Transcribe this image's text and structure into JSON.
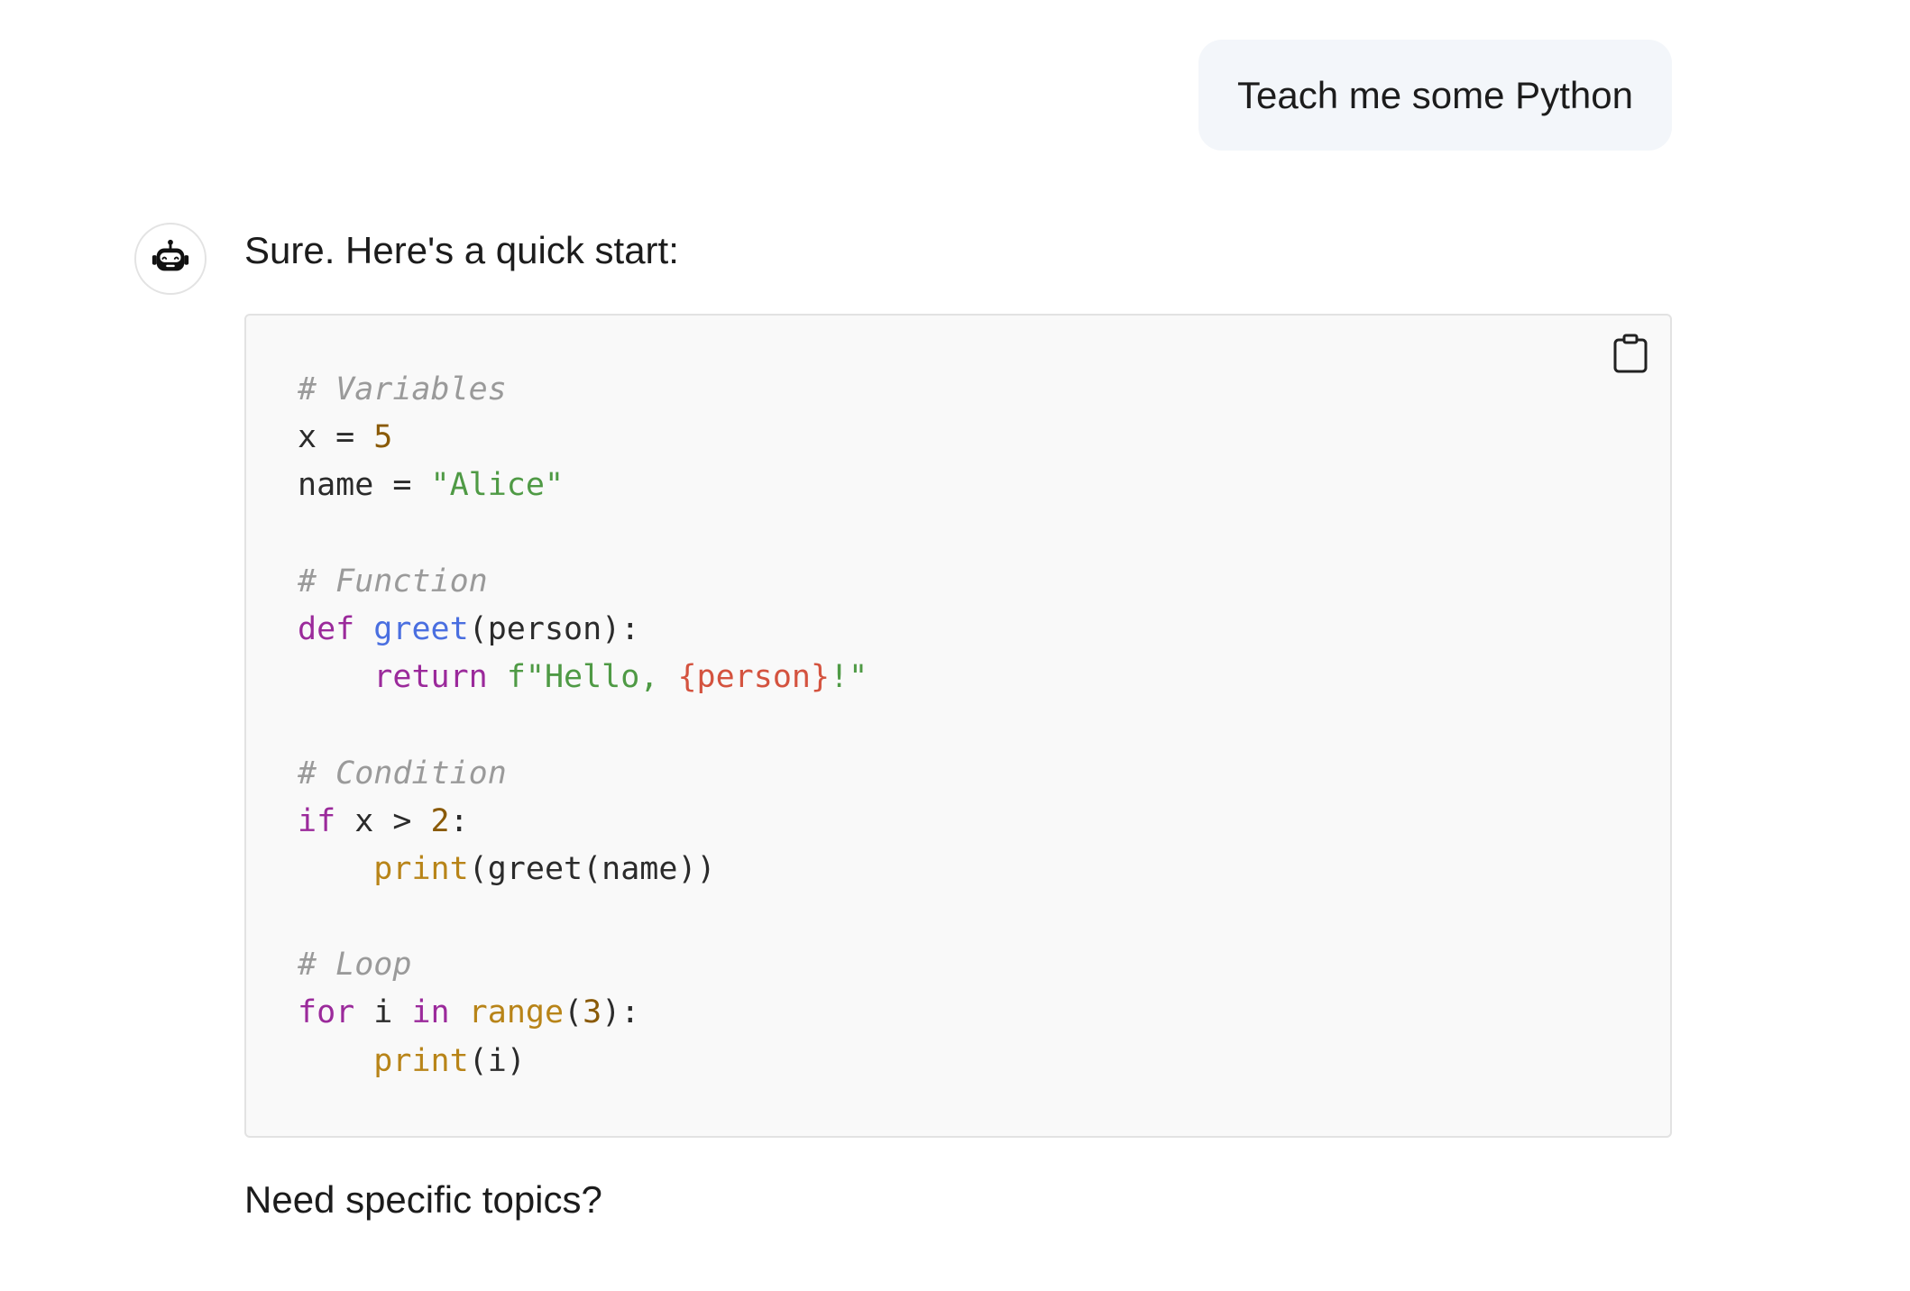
{
  "user_message": {
    "text": "Teach me some Python"
  },
  "assistant": {
    "avatar_icon": "robot-icon",
    "intro": "Sure. Here's a quick start:",
    "outro": "Need specific topics?",
    "code_block": {
      "language": "python",
      "copy_icon": "clipboard-icon",
      "lines": [
        [
          {
            "t": "comment",
            "v": "# Variables"
          }
        ],
        [
          {
            "t": "plain",
            "v": "x = "
          },
          {
            "t": "number",
            "v": "5"
          }
        ],
        [
          {
            "t": "plain",
            "v": "name = "
          },
          {
            "t": "string",
            "v": "\"Alice\""
          }
        ],
        [],
        [
          {
            "t": "comment",
            "v": "# Function"
          }
        ],
        [
          {
            "t": "keyword",
            "v": "def"
          },
          {
            "t": "plain",
            "v": " "
          },
          {
            "t": "funcname",
            "v": "greet"
          },
          {
            "t": "plain",
            "v": "(person):"
          }
        ],
        [
          {
            "t": "plain",
            "v": "    "
          },
          {
            "t": "keyword",
            "v": "return"
          },
          {
            "t": "plain",
            "v": " "
          },
          {
            "t": "string",
            "v": "f\"Hello, "
          },
          {
            "t": "interp",
            "v": "{person}"
          },
          {
            "t": "string",
            "v": "!\""
          }
        ],
        [],
        [
          {
            "t": "comment",
            "v": "# Condition"
          }
        ],
        [
          {
            "t": "keyword",
            "v": "if"
          },
          {
            "t": "plain",
            "v": " x > "
          },
          {
            "t": "number",
            "v": "2"
          },
          {
            "t": "plain",
            "v": ":"
          }
        ],
        [
          {
            "t": "plain",
            "v": "    "
          },
          {
            "t": "builtin",
            "v": "print"
          },
          {
            "t": "plain",
            "v": "(greet(name))"
          }
        ],
        [],
        [
          {
            "t": "comment",
            "v": "# Loop"
          }
        ],
        [
          {
            "t": "keyword",
            "v": "for"
          },
          {
            "t": "plain",
            "v": " i "
          },
          {
            "t": "keyword",
            "v": "in"
          },
          {
            "t": "plain",
            "v": " "
          },
          {
            "t": "builtin",
            "v": "range"
          },
          {
            "t": "plain",
            "v": "("
          },
          {
            "t": "number",
            "v": "3"
          },
          {
            "t": "plain",
            "v": "):"
          }
        ],
        [
          {
            "t": "plain",
            "v": "    "
          },
          {
            "t": "builtin",
            "v": "print"
          },
          {
            "t": "plain",
            "v": "(i)"
          }
        ]
      ]
    }
  },
  "colors": {
    "user_bubble_bg": "#f3f6fa",
    "code_bg": "#f9f9f9",
    "comment": "#9a9a9a",
    "keyword": "#9b2a9b",
    "string": "#4f9a45",
    "number": "#8a5a07",
    "function_name": "#4a6fe0",
    "builtin": "#b88418",
    "interpolation": "#d4533f"
  }
}
